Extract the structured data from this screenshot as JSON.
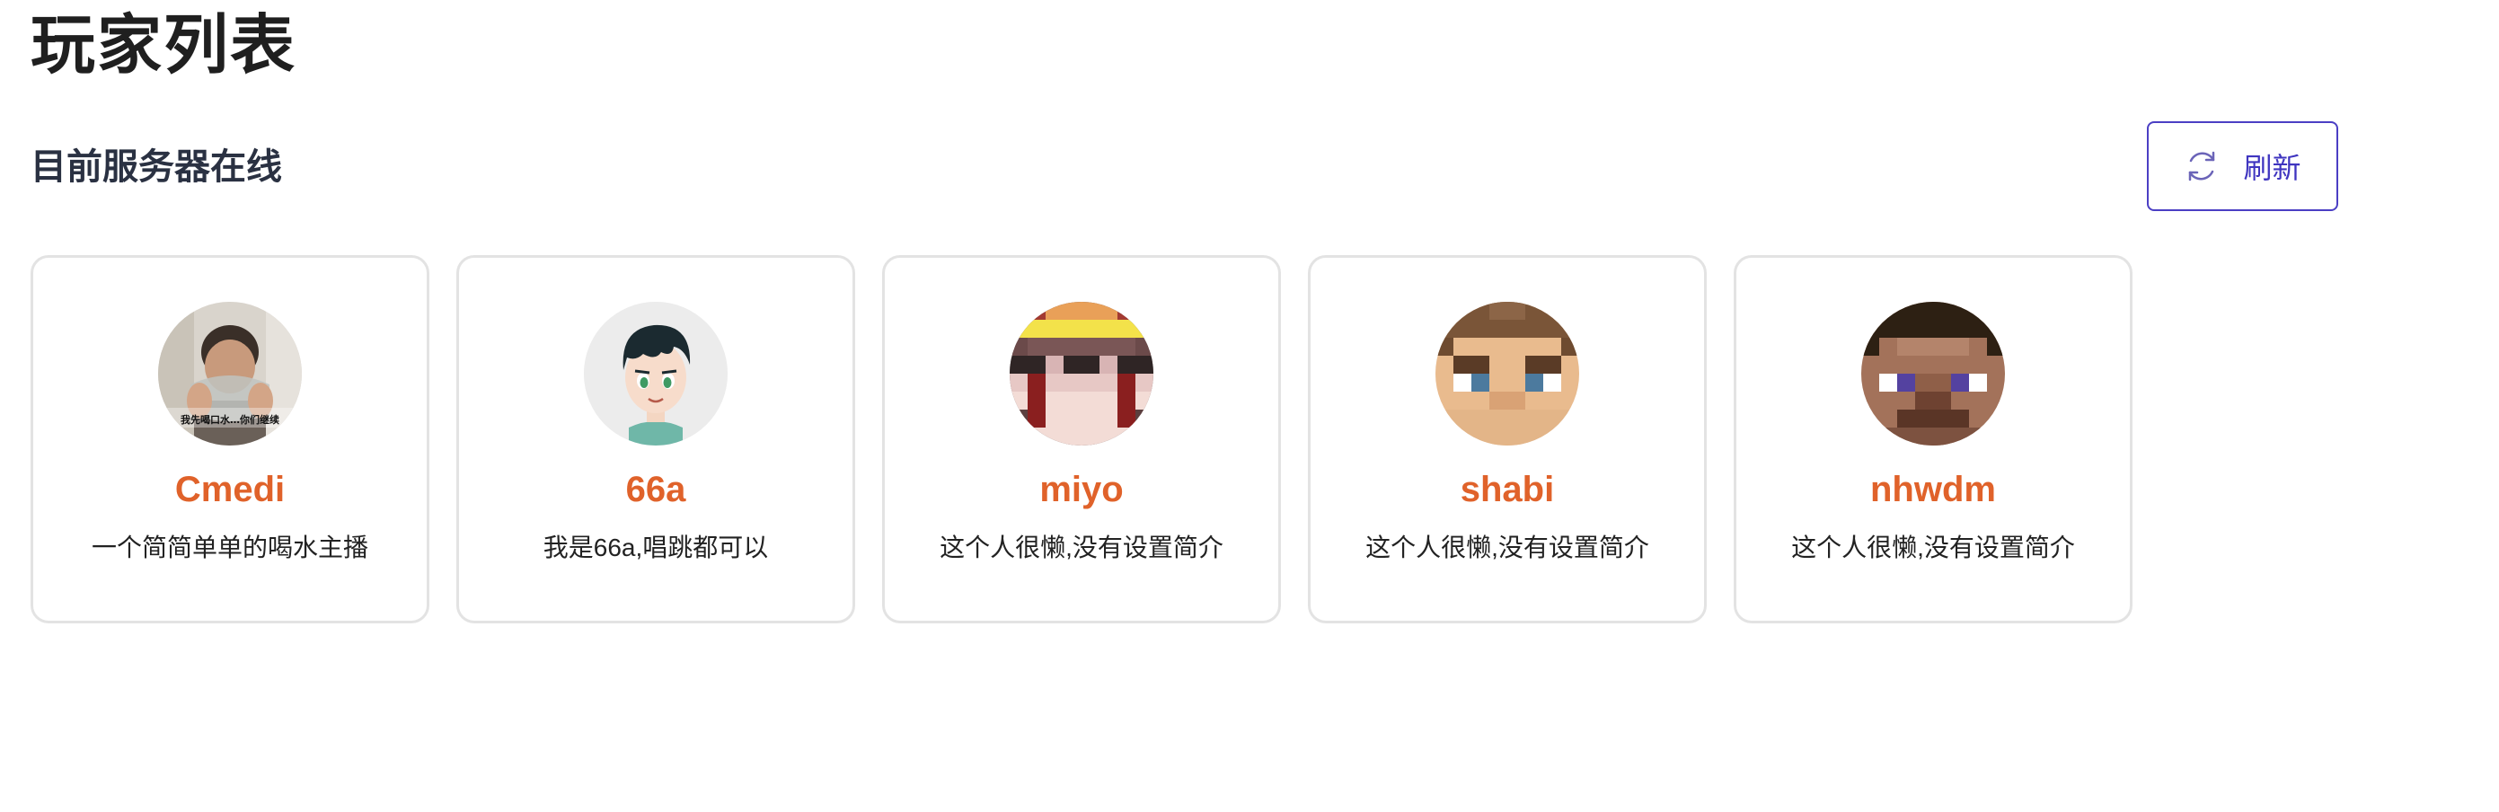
{
  "header": {
    "title": "玩家列表"
  },
  "section": {
    "subtitle": "目前服务器在线",
    "refresh_label": "刷新"
  },
  "players": [
    {
      "name": "Cmedi",
      "bio": "一个简简单单的喝水主播",
      "avatar_caption": "我先喝口水…你们继续"
    },
    {
      "name": "66a",
      "bio": "我是66a,唱跳都可以"
    },
    {
      "name": "miyo",
      "bio": "这个人很懒,没有设置简介"
    },
    {
      "name": "shabi",
      "bio": "这个人很懒,没有设置简介"
    },
    {
      "name": "nhwdm",
      "bio": "这个人很懒,没有设置简介"
    }
  ],
  "colors": {
    "accent": "#4b3fc4",
    "player_name": "#e0622a",
    "card_border": "#e3e3e3"
  },
  "icons": {
    "refresh": "refresh-icon"
  }
}
